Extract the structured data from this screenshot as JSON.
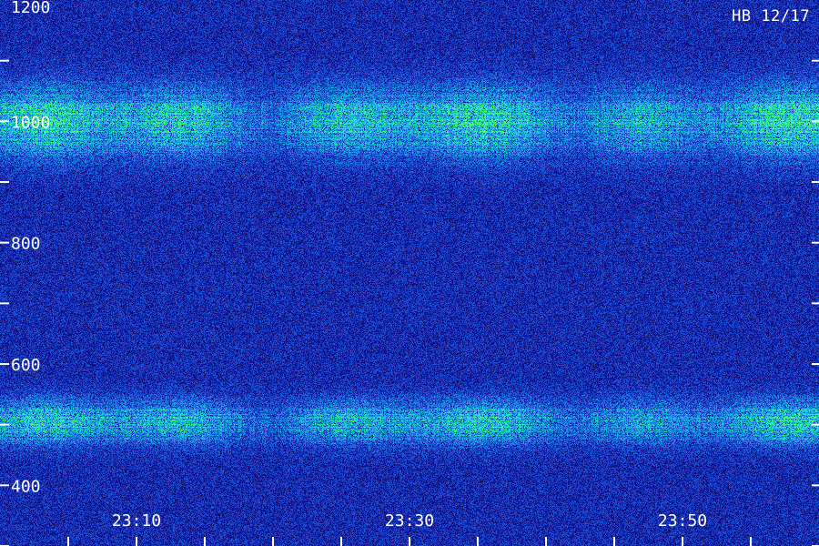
{
  "station_label": "HB 12/17",
  "chart_data": {
    "type": "heatmap",
    "title": "",
    "xlabel": "",
    "ylabel": "",
    "x_tick_labels": [
      "23:10",
      "23:30",
      "23:50"
    ],
    "x_tick_values_min": [
      10,
      30,
      50
    ],
    "x_minor_tick_values_min": [
      5,
      10,
      15,
      20,
      25,
      30,
      35,
      40,
      45,
      50,
      55
    ],
    "xlim_min": [
      0,
      60
    ],
    "y_tick_labels": [
      "400",
      "600",
      "800",
      "1000",
      "1200"
    ],
    "y_tick_values": [
      400,
      600,
      800,
      1000,
      1200
    ],
    "y_minor_tick_values": [
      300,
      400,
      500,
      600,
      700,
      800,
      900,
      1000,
      1100
    ],
    "ylim": [
      300,
      1200
    ],
    "bands": [
      {
        "low": 455,
        "high": 545,
        "center": 505,
        "intensity": 0.85
      },
      {
        "low": 935,
        "high": 1080,
        "center": 1000,
        "intensity": 0.9
      }
    ],
    "colormap": [
      "#060622",
      "#12129a",
      "#1c4fd6",
      "#19a7e6",
      "#22e3b9",
      "#5cff6a"
    ]
  }
}
